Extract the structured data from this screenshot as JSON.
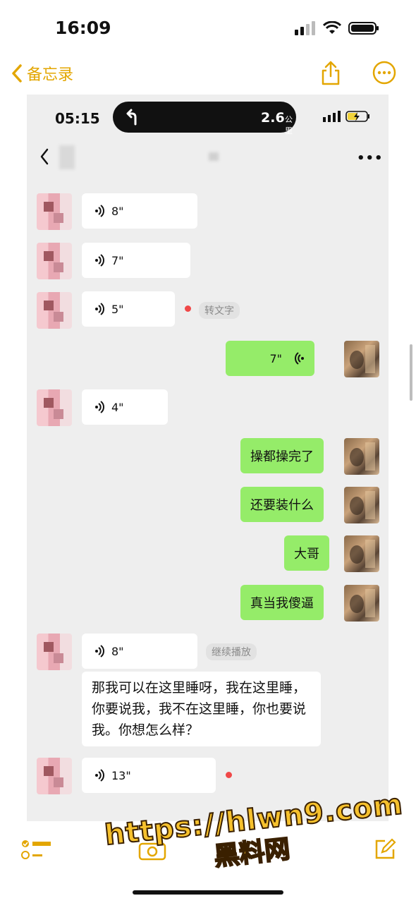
{
  "status_bar": {
    "time": "16:09"
  },
  "notes_nav": {
    "back_label": "备忘录",
    "accent_color": "#e3a600"
  },
  "screenshot": {
    "inner_status": {
      "time": "05:15",
      "nav_distance": "2.6",
      "nav_unit": "公里"
    },
    "messages": [
      {
        "side": "left",
        "type": "voice",
        "duration": "8\""
      },
      {
        "side": "left",
        "type": "voice",
        "duration": "7\""
      },
      {
        "side": "left",
        "type": "voice",
        "duration": "5\"",
        "unread": true,
        "action": "转文字"
      },
      {
        "side": "right",
        "type": "voice",
        "duration": "7\""
      },
      {
        "side": "left",
        "type": "voice",
        "duration": "4\""
      },
      {
        "side": "right",
        "type": "text",
        "text": "操都操完了"
      },
      {
        "side": "right",
        "type": "text",
        "text": "还要装什么"
      },
      {
        "side": "right",
        "type": "text",
        "text": "大哥"
      },
      {
        "side": "right",
        "type": "text",
        "text": "真当我傻逼"
      },
      {
        "side": "left",
        "type": "voice",
        "duration": "8\"",
        "action": "继续播放",
        "transcript": "那我可以在这里睡呀，我在这里睡，你要说我，我不在这里睡，你也要说我。你想怎么样？"
      },
      {
        "side": "left",
        "type": "voice",
        "duration": "13\"",
        "unread": true
      }
    ],
    "bubble_color_green": "#95ec69"
  },
  "watermark": {
    "url": "https://hlwn9.com",
    "name": "黑料网"
  }
}
